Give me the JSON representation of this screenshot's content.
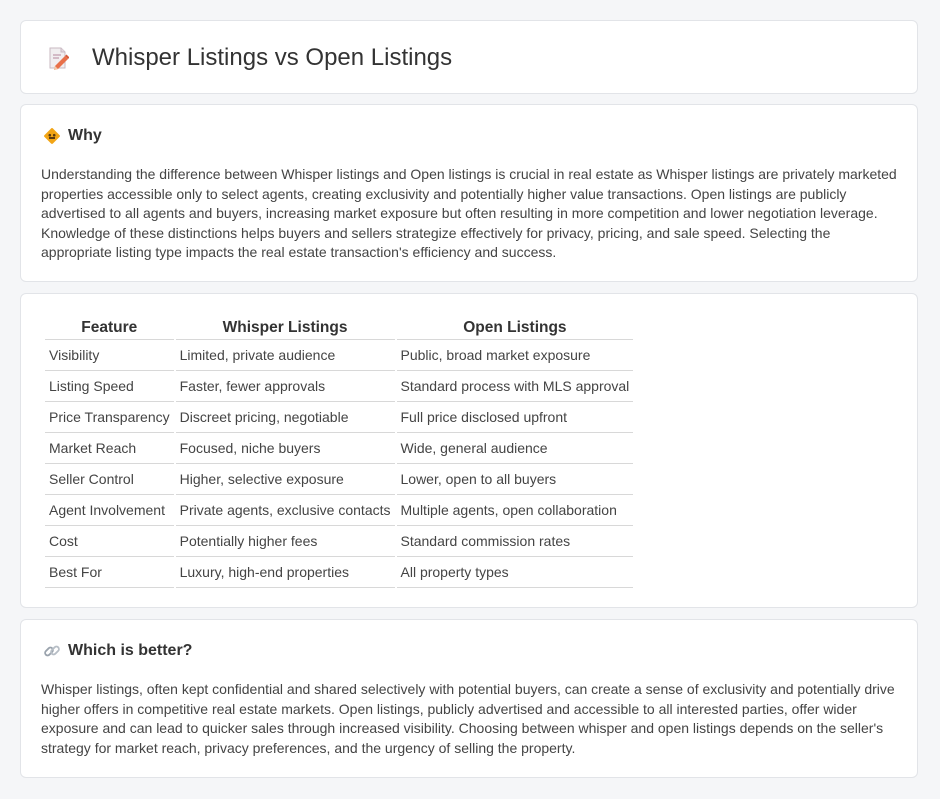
{
  "page": {
    "title": "Whisper Listings vs Open Listings",
    "title_icon": "pencil-document-icon"
  },
  "why": {
    "heading": "Why",
    "icon": "diamond-warning-icon",
    "text": "Understanding the difference between Whisper listings and Open listings is crucial in real estate as Whisper listings are privately marketed properties accessible only to select agents, creating exclusivity and potentially higher value transactions. Open listings are publicly advertised to all agents and buyers, increasing market exposure but often resulting in more competition and lower negotiation leverage. Knowledge of these distinctions helps buyers and sellers strategize effectively for privacy, pricing, and sale speed. Selecting the appropriate listing type impacts the real estate transaction's efficiency and success."
  },
  "table": {
    "headers": [
      "Feature",
      "Whisper Listings",
      "Open Listings"
    ],
    "rows": [
      [
        "Visibility",
        "Limited, private audience",
        "Public, broad market exposure"
      ],
      [
        "Listing Speed",
        "Faster, fewer approvals",
        "Standard process with MLS approval"
      ],
      [
        "Price Transparency",
        "Discreet pricing, negotiable",
        "Full price disclosed upfront"
      ],
      [
        "Market Reach",
        "Focused, niche buyers",
        "Wide, general audience"
      ],
      [
        "Seller Control",
        "Higher, selective exposure",
        "Lower, open to all buyers"
      ],
      [
        "Agent Involvement",
        "Private agents, exclusive contacts",
        "Multiple agents, open collaboration"
      ],
      [
        "Cost",
        "Potentially higher fees",
        "Standard commission rates"
      ],
      [
        "Best For",
        "Luxury, high-end properties",
        "All property types"
      ]
    ]
  },
  "better": {
    "heading": "Which is better?",
    "icon": "link-icon",
    "text": "Whisper listings, often kept confidential and shared selectively with potential buyers, can create a sense of exclusivity and potentially drive higher offers in competitive real estate markets. Open listings, publicly advertised and accessible to all interested parties, offer wider exposure and can lead to quicker sales through increased visibility. Choosing between whisper and open listings depends on the seller's strategy for market reach, privacy preferences, and the urgency of selling the property."
  }
}
